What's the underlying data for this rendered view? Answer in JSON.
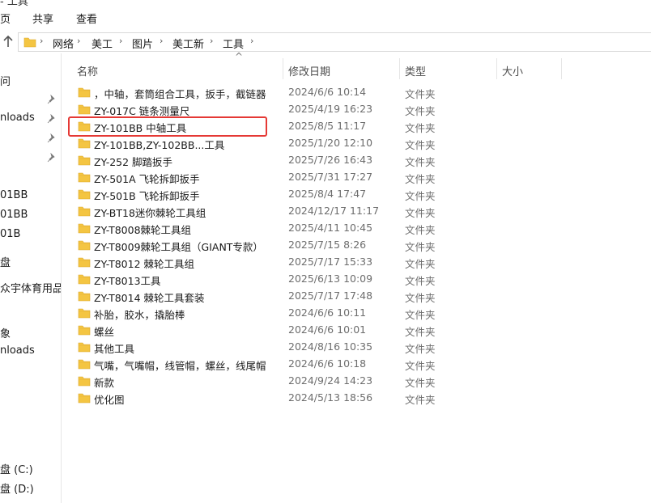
{
  "window": {
    "title_fragment": "- 工具"
  },
  "ribbon": {
    "tabs": [
      "页",
      "共享",
      "查看"
    ]
  },
  "address": {
    "crumbs": [
      "网络",
      "美工",
      "图片",
      "美工新",
      "工具"
    ]
  },
  "nav": {
    "items": [
      "问",
      "nloads",
      "01BB",
      "01BB",
      "01B",
      "盘",
      "众宇体育用品有",
      "象",
      "nloads",
      "盘 (C:)",
      "盘 (D:)"
    ]
  },
  "columns": {
    "name": "名称",
    "date": "修改日期",
    "type": "类型",
    "size": "大小"
  },
  "files": [
    {
      "name": "，中轴，套筒组合工具，扳手，截链器",
      "date": "2024/6/6 10:14",
      "type": "文件夹"
    },
    {
      "name": "ZY-017C  链条测量尺",
      "date": "2025/4/19 16:23",
      "type": "文件夹"
    },
    {
      "name": "ZY-101BB  中轴工具",
      "date": "2025/8/5 11:17",
      "type": "文件夹"
    },
    {
      "name": "ZY-101BB,ZY-102BB...工具",
      "date": "2025/1/20 12:10",
      "type": "文件夹"
    },
    {
      "name": "ZY-252 脚踏扳手",
      "date": "2025/7/26 16:43",
      "type": "文件夹"
    },
    {
      "name": "ZY-501A  飞轮拆卸扳手",
      "date": "2025/7/31 17:27",
      "type": "文件夹"
    },
    {
      "name": "ZY-501B 飞轮拆卸扳手",
      "date": "2025/8/4 17:47",
      "type": "文件夹"
    },
    {
      "name": "ZY-BT18迷你棘轮工具组",
      "date": "2024/12/17 11:17",
      "type": "文件夹"
    },
    {
      "name": "ZY-T8008棘轮工具组",
      "date": "2025/4/11 10:45",
      "type": "文件夹"
    },
    {
      "name": "ZY-T8009棘轮工具组（GIANT专款）",
      "date": "2025/7/15 8:26",
      "type": "文件夹"
    },
    {
      "name": "ZY-T8012 棘轮工具组",
      "date": "2025/7/17 15:33",
      "type": "文件夹"
    },
    {
      "name": "ZY-T8013工具",
      "date": "2025/6/13 10:09",
      "type": "文件夹"
    },
    {
      "name": "ZY-T8014 棘轮工具套装",
      "date": "2025/7/17 17:48",
      "type": "文件夹"
    },
    {
      "name": "补胎，胶水，撬胎棒",
      "date": "2024/6/6 10:11",
      "type": "文件夹"
    },
    {
      "name": "螺丝",
      "date": "2024/6/6 10:01",
      "type": "文件夹"
    },
    {
      "name": "其他工具",
      "date": "2024/8/16 10:35",
      "type": "文件夹"
    },
    {
      "name": "气嘴，气嘴帽，线管帽，螺丝，线尾帽",
      "date": "2024/6/6 10:18",
      "type": "文件夹"
    },
    {
      "name": "新款",
      "date": "2024/9/24 14:23",
      "type": "文件夹"
    },
    {
      "name": "优化图",
      "date": "2024/5/13 18:56",
      "type": "文件夹"
    }
  ],
  "highlighted_row": 2,
  "colors": {
    "folder": "#f4c542",
    "highlight": "#e53935"
  }
}
